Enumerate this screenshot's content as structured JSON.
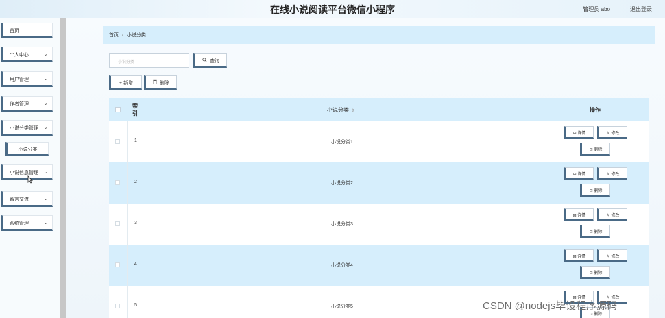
{
  "header": {
    "title": "在线小说阅读平台微信小程序",
    "user_label": "管理员 abo",
    "logout_label": "退出登录"
  },
  "sidebar": {
    "items": [
      {
        "label": "首页",
        "arrow": ""
      },
      {
        "label": "个人中心",
        "arrow": "⌄"
      },
      {
        "label": "用户管理",
        "arrow": "⌄"
      },
      {
        "label": "作者管理",
        "arrow": "⌄"
      },
      {
        "label": "小说分类管理",
        "arrow": "⌄"
      },
      {
        "label": "小说信息管理",
        "arrow": "⌄"
      },
      {
        "label": "留言交流",
        "arrow": "⌄"
      },
      {
        "label": "系统管理",
        "arrow": "⌄"
      }
    ],
    "subitem": {
      "label": "小说分类"
    }
  },
  "breadcrumb": {
    "home": "首页",
    "separator": "/",
    "current": "小说分类"
  },
  "search": {
    "placeholder": "小说分类",
    "button_label": "查询",
    "button_icon": "search-icon"
  },
  "actions": {
    "add_label": "新增",
    "delete_label": "删除"
  },
  "table": {
    "headers": {
      "index": "索引",
      "name": "小说分类",
      "sort_icon": "⇕",
      "operation": "操作"
    },
    "rows": [
      {
        "index": "1",
        "name": "小说分类1"
      },
      {
        "index": "2",
        "name": "小说分类2"
      },
      {
        "index": "3",
        "name": "小说分类3"
      },
      {
        "index": "4",
        "name": "小说分类4"
      },
      {
        "index": "5",
        "name": "小说分类5"
      }
    ],
    "row_actions": {
      "detail": "详情",
      "edit": "修改",
      "delete": "删除"
    }
  },
  "watermark": "CSDN @nodejs毕设程序源码",
  "colors": {
    "accent_border": "#4a6a86",
    "row_highlight": "#d6eefc",
    "background": "#eef6fb"
  }
}
